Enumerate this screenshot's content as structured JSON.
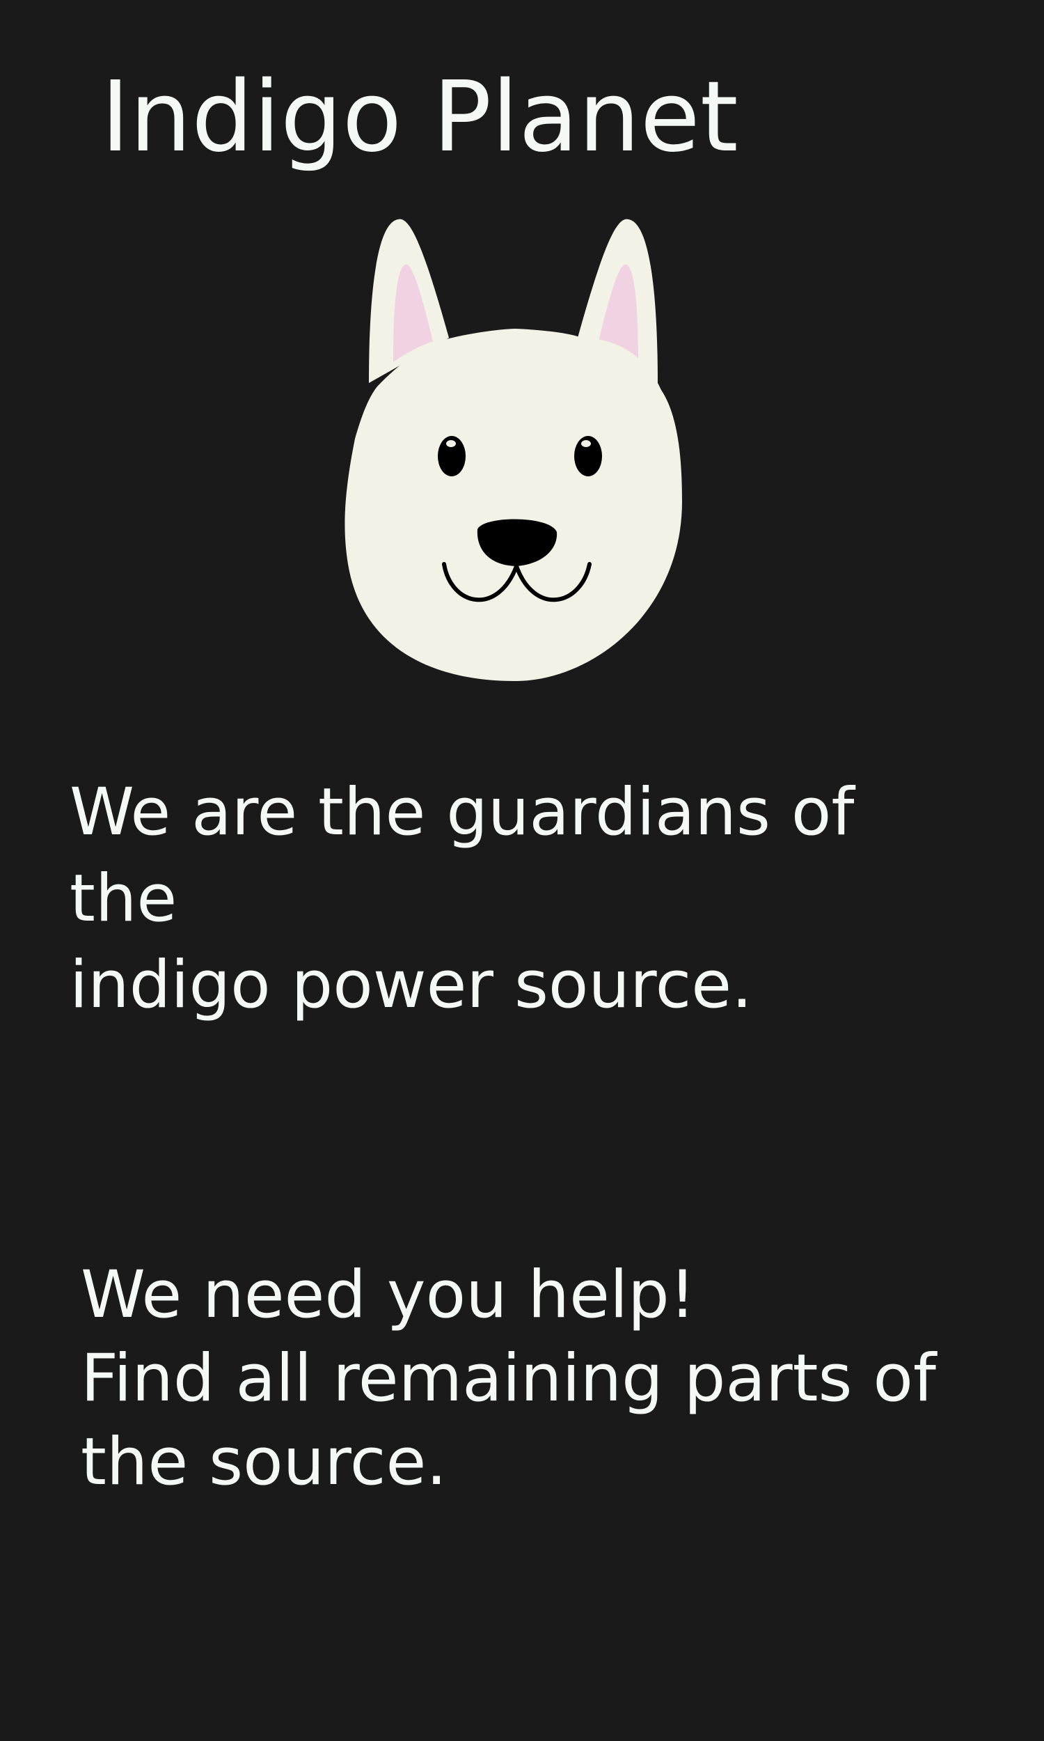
{
  "app": {
    "title": "Indigo Planet"
  },
  "mascot": {
    "icon": "dog-face-icon",
    "colors": {
      "face": "#f2f2e6",
      "inner_ear": "#f0d2e3",
      "features": "#000000"
    }
  },
  "story": {
    "intro_lines": [
      "We are the guardians of the",
      "indigo power source."
    ],
    "help_lines": [
      "We need you help!",
      "Find all remaining parts of",
      "the source."
    ]
  },
  "colors": {
    "background": "#1a1a1a",
    "text": "#f4f9f5"
  }
}
